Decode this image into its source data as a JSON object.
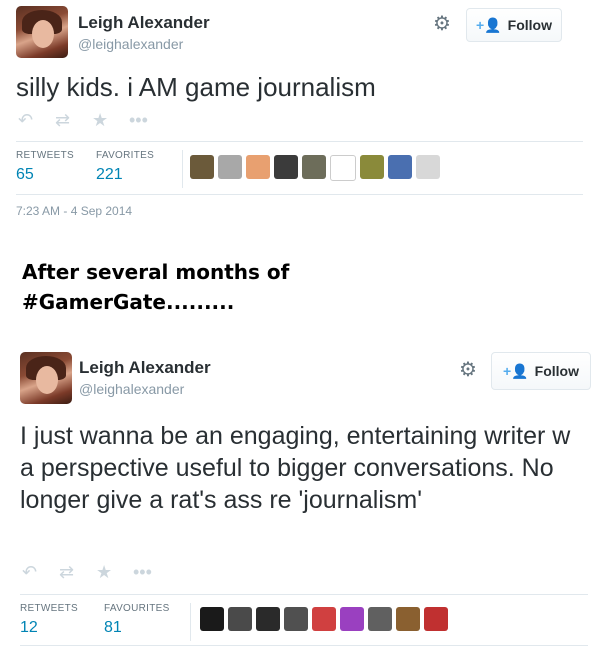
{
  "tweet1": {
    "name": "Leigh Alexander",
    "handle": "@leighalexander",
    "follow_label": "Follow",
    "text": "silly kids. i AM game journalism",
    "retweets_label": "RETWEETS",
    "retweets": "65",
    "favorites_label": "FAVORITES",
    "favorites": "221",
    "timestamp": "7:23 AM - 4 Sep 2014",
    "fav_avatar_colors": [
      "#6b5a3a",
      "#a8a8a8",
      "#e8a070",
      "#3b3b3b",
      "#6d6d5a",
      "#ffffff",
      "#8a8a3a",
      "#4a6fb0",
      "#d8d8d8"
    ]
  },
  "caption": {
    "line1": "After several months of",
    "line2": "#GamerGate........."
  },
  "tweet2": {
    "name": "Leigh Alexander",
    "handle": "@leighalexander",
    "follow_label": "Follow",
    "text": "I just wanna be an engaging, entertaining writer w a perspective useful to bigger conversations. No longer give a rat's ass re 'journalism'",
    "retweets_label": "RETWEETS",
    "retweets": "12",
    "favorites_label": "FAVOURITES",
    "favorites": "81",
    "fav_avatar_colors": [
      "#1a1a1a",
      "#4a4a4a",
      "#2a2a2a",
      "#505050",
      "#d04040",
      "#9a40c0",
      "#606060",
      "#8a6030",
      "#c03030"
    ]
  },
  "icons": {
    "reply": "reply-icon",
    "retweet": "retweet-icon",
    "favorite": "star-icon",
    "more": "more-icon",
    "settings": "gear-icon",
    "follow": "add-user-icon"
  },
  "colors": {
    "link": "#0084b4",
    "follow_accent": "#55acee",
    "muted": "#8899a6"
  }
}
